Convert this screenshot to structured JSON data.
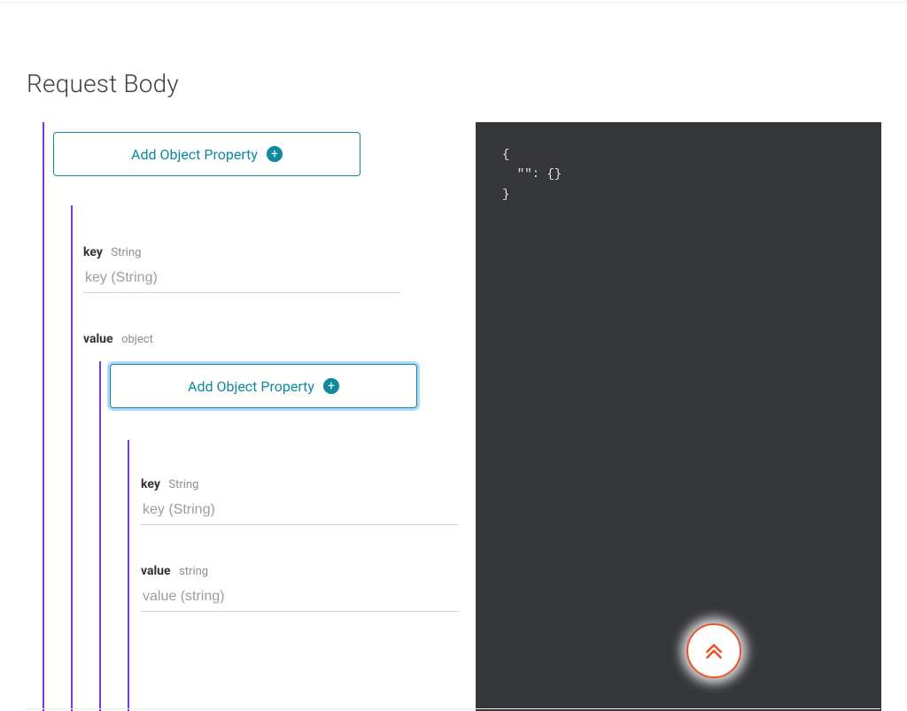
{
  "title": "Request Body",
  "left": {
    "add_button_label": "Add Object Property",
    "level1": {
      "key": {
        "label": "key",
        "type": "String",
        "placeholder": "key (String)",
        "value": ""
      },
      "value": {
        "label": "value",
        "type": "object",
        "add_button_label": "Add Object Property",
        "child": {
          "key": {
            "label": "key",
            "type": "String",
            "placeholder": "key (String)",
            "value": ""
          },
          "value": {
            "label": "value",
            "type": "string",
            "placeholder": "value (string)",
            "value": ""
          }
        }
      }
    }
  },
  "code": "{\n  \"\": {}\n}",
  "colors": {
    "teal": "#0f899d",
    "purple": "#7a3bdc",
    "orange": "#e9562b",
    "codebg": "#34363a"
  }
}
